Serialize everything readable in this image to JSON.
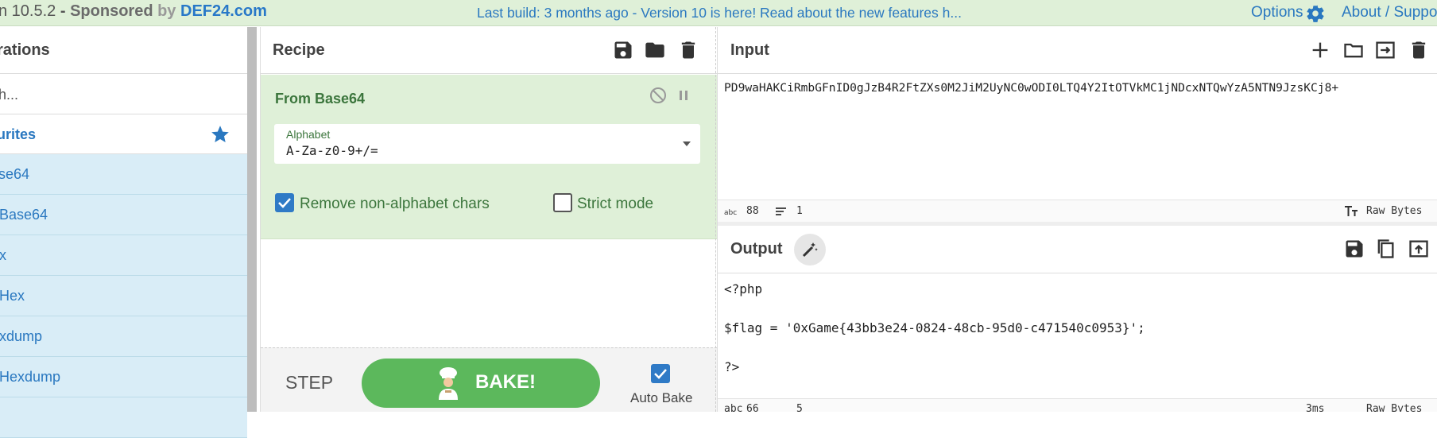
{
  "banner": {
    "version": "n 10.5.2",
    "sep": " - ",
    "sponsored": "Sponsored",
    "by": "by",
    "brand": "DEF24.com",
    "build_notice": "Last build: 3 months ago - Version 10 is here! Read about the new features h...",
    "options": "Options",
    "about": "About / Suppor"
  },
  "operations": {
    "title": "rations",
    "search_placeholder": "h...",
    "favourites": "urites",
    "items": [
      {
        "label": "se64"
      },
      {
        "label": "Base64"
      },
      {
        "label": "x"
      },
      {
        "label": "Hex"
      },
      {
        "label": "xdump"
      },
      {
        "label": "Hexdump"
      }
    ]
  },
  "recipe": {
    "title": "Recipe",
    "operation": {
      "name": "From Base64",
      "alphabet_label": "Alphabet",
      "alphabet_value": "A-Za-z0-9+/=",
      "remove_nonalpha_label": "Remove non-alphabet chars",
      "remove_nonalpha_checked": true,
      "strict_mode_label": "Strict mode",
      "strict_mode_checked": false
    },
    "step_label": "STEP",
    "bake_label": "BAKE!",
    "auto_bake_label": "Auto Bake",
    "auto_bake_checked": true
  },
  "input": {
    "title": "Input",
    "text": "PD9waHAKCiRmbGFnID0gJzB4R2FtZXs0M2JiM2UyNC0wODI0LTQ4Y2ItOTVkMC1jNDcxNTQwYzA5NTN9JzsKCj8+",
    "chars": "88",
    "lines": "1",
    "encoding": "Raw Bytes"
  },
  "output": {
    "title": "Output",
    "lines": [
      "<?php",
      "",
      "$flag = '0xGame{43bb3e24-0824-48cb-95d0-c471540c0953}';",
      "",
      "?>"
    ],
    "chars": "66",
    "line_count": "5",
    "time": "3ms",
    "encoding": "Raw Bytes"
  },
  "colors": {
    "accent_blue": "#2a78c0",
    "banner_bg": "#dff0d8",
    "recipe_green": "#3c763d",
    "bake_green": "#5cb85c",
    "op_item_bg": "#d9edf7"
  },
  "icons": [
    "gear-icon",
    "star-icon",
    "save-icon",
    "folder-icon",
    "trash-icon",
    "disable-icon",
    "pause-icon",
    "plus-icon",
    "swap-icon",
    "magic-wand-icon",
    "copy-icon",
    "replace-input-icon",
    "text-size-icon",
    "lines-icon",
    "clock-icon",
    "chef-icon"
  ]
}
